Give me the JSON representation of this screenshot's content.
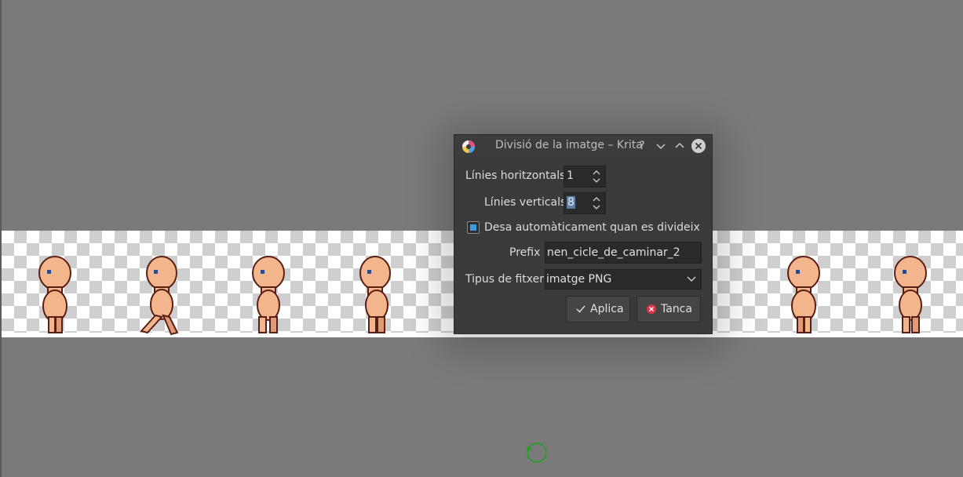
{
  "dialog": {
    "title": "Divisió de la imatge – Krita",
    "help_glyph": "?",
    "horizontal_lines_label": "Línies horitzontals",
    "horizontal_lines_value": "1",
    "vertical_lines_label": "Línies verticals",
    "vertical_lines_value": "8",
    "autosave_label": "Desa automàticament quan es divideix",
    "autosave_checked": true,
    "prefix_label": "Prefix",
    "prefix_value": "nen_cicle_de_caminar_2",
    "file_type_label": "Tipus de fitxer",
    "file_type_value": "imatge PNG",
    "apply_label": "Aplica",
    "close_label": "Tanca"
  },
  "icons": {
    "app": "krita-app-icon",
    "help": "help-icon",
    "minimize": "chevron-down-icon",
    "maximize": "chevron-up-icon",
    "close": "close-icon",
    "apply": "checkmark-icon",
    "cancel": "cancel-icon",
    "cursor": "busy-cursor-icon"
  },
  "colors": {
    "canvas_bg": "#7a7a7a",
    "dialog_bg": "#3a3a3a",
    "accent": "#3d9be0",
    "skin": "#f2b58c",
    "outline": "#5a1f14"
  },
  "canvas": {
    "sprite_count": 9
  }
}
